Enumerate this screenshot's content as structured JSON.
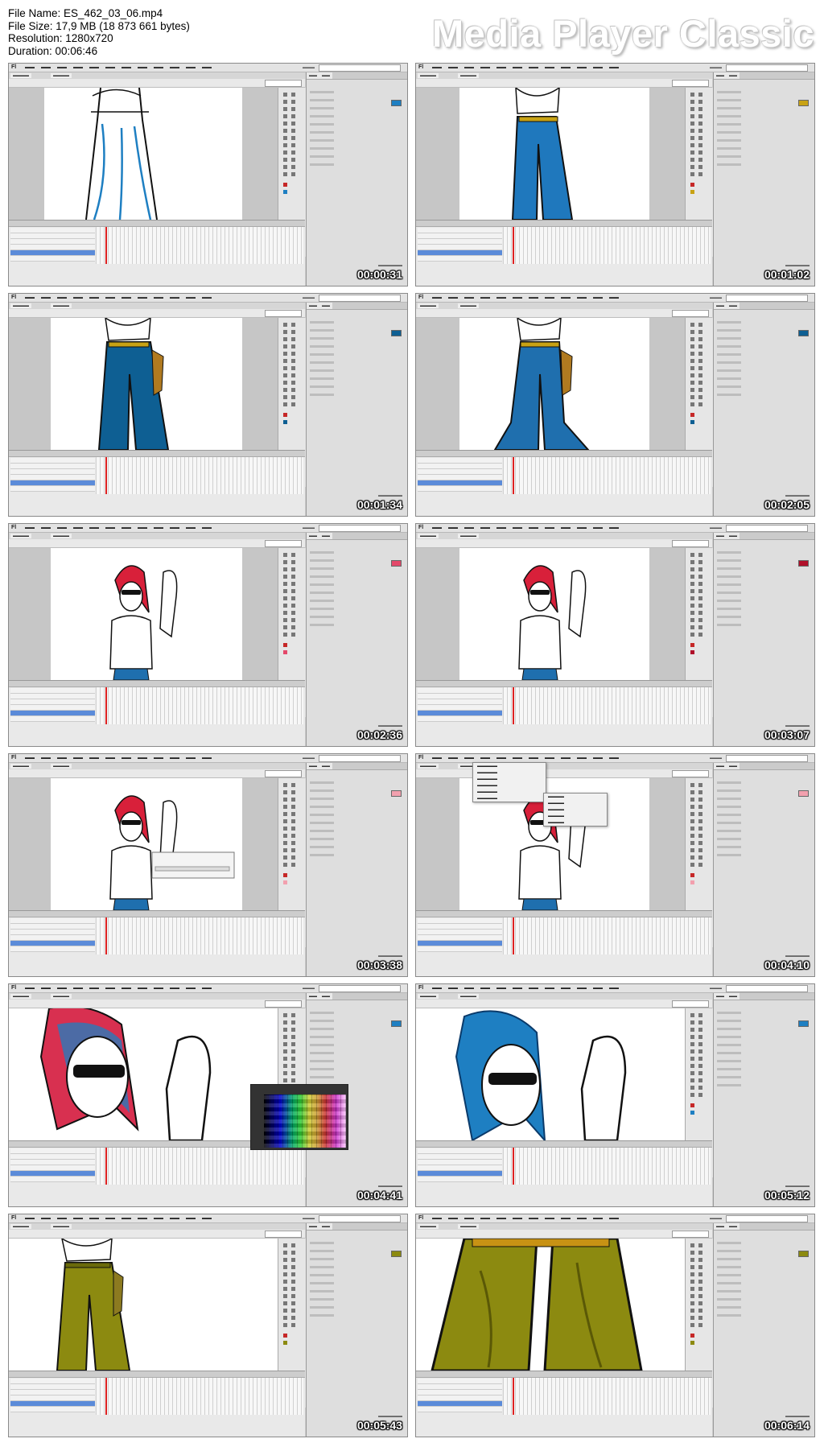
{
  "header": {
    "file_name": "File Name: ES_462_03_06.mp4",
    "file_size": "File Size: 17,9 MB (18 873 661 bytes)",
    "resolution": "Resolution: 1280x720",
    "duration": "Duration: 00:06:46",
    "brand": "Media Player Classic"
  },
  "thumbnails": [
    {
      "timestamp": "00:00:31",
      "fill_color": "#1e7fc2",
      "drawing": "legs-outline"
    },
    {
      "timestamp": "00:01:02",
      "fill_color": "#c8a214",
      "drawing": "legs-blue"
    },
    {
      "timestamp": "00:01:34",
      "fill_color": "#0e5f93",
      "drawing": "legs-blue-holster"
    },
    {
      "timestamp": "00:02:05",
      "fill_color": "#0e5f93",
      "drawing": "legs-blue-bell"
    },
    {
      "timestamp": "00:02:36",
      "fill_color": "#e4486a",
      "drawing": "girl-red-hair"
    },
    {
      "timestamp": "00:03:07",
      "fill_color": "#b0102a",
      "drawing": "girl-red-hair"
    },
    {
      "timestamp": "00:03:38",
      "fill_color": "#f2a0ae",
      "drawing": "girl-dialog"
    },
    {
      "timestamp": "00:04:10",
      "fill_color": "#f2a0ae",
      "drawing": "girl-menu"
    },
    {
      "timestamp": "00:04:41",
      "fill_color": "#1e7fc2",
      "drawing": "face-closeup-palette"
    },
    {
      "timestamp": "00:05:12",
      "fill_color": "#1e7fc2",
      "drawing": "face-closeup-blue"
    },
    {
      "timestamp": "00:05:43",
      "fill_color": "#8c8a10",
      "drawing": "legs-olive"
    },
    {
      "timestamp": "00:06:14",
      "fill_color": "#8c8a10",
      "drawing": "legs-olive-closeup"
    }
  ]
}
